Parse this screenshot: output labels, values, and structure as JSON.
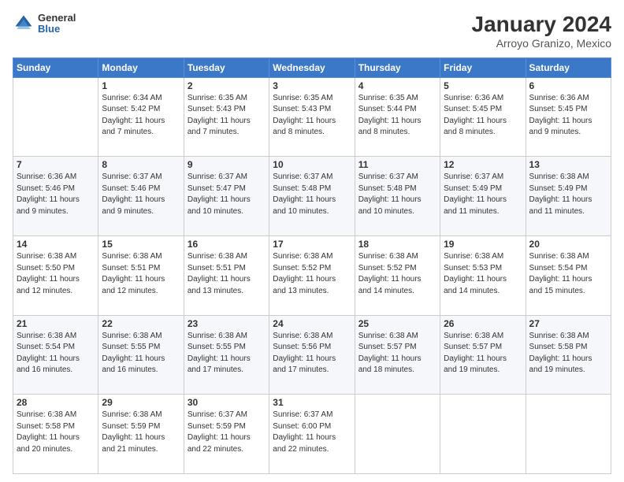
{
  "logo": {
    "general": "General",
    "blue": "Blue"
  },
  "header": {
    "month": "January 2024",
    "location": "Arroyo Granizo, Mexico"
  },
  "weekdays": [
    "Sunday",
    "Monday",
    "Tuesday",
    "Wednesday",
    "Thursday",
    "Friday",
    "Saturday"
  ],
  "weeks": [
    [
      {
        "day": "",
        "info": ""
      },
      {
        "day": "1",
        "info": "Sunrise: 6:34 AM\nSunset: 5:42 PM\nDaylight: 11 hours\nand 7 minutes."
      },
      {
        "day": "2",
        "info": "Sunrise: 6:35 AM\nSunset: 5:43 PM\nDaylight: 11 hours\nand 7 minutes."
      },
      {
        "day": "3",
        "info": "Sunrise: 6:35 AM\nSunset: 5:43 PM\nDaylight: 11 hours\nand 8 minutes."
      },
      {
        "day": "4",
        "info": "Sunrise: 6:35 AM\nSunset: 5:44 PM\nDaylight: 11 hours\nand 8 minutes."
      },
      {
        "day": "5",
        "info": "Sunrise: 6:36 AM\nSunset: 5:45 PM\nDaylight: 11 hours\nand 8 minutes."
      },
      {
        "day": "6",
        "info": "Sunrise: 6:36 AM\nSunset: 5:45 PM\nDaylight: 11 hours\nand 9 minutes."
      }
    ],
    [
      {
        "day": "7",
        "info": "Sunrise: 6:36 AM\nSunset: 5:46 PM\nDaylight: 11 hours\nand 9 minutes."
      },
      {
        "day": "8",
        "info": "Sunrise: 6:37 AM\nSunset: 5:46 PM\nDaylight: 11 hours\nand 9 minutes."
      },
      {
        "day": "9",
        "info": "Sunrise: 6:37 AM\nSunset: 5:47 PM\nDaylight: 11 hours\nand 10 minutes."
      },
      {
        "day": "10",
        "info": "Sunrise: 6:37 AM\nSunset: 5:48 PM\nDaylight: 11 hours\nand 10 minutes."
      },
      {
        "day": "11",
        "info": "Sunrise: 6:37 AM\nSunset: 5:48 PM\nDaylight: 11 hours\nand 10 minutes."
      },
      {
        "day": "12",
        "info": "Sunrise: 6:37 AM\nSunset: 5:49 PM\nDaylight: 11 hours\nand 11 minutes."
      },
      {
        "day": "13",
        "info": "Sunrise: 6:38 AM\nSunset: 5:49 PM\nDaylight: 11 hours\nand 11 minutes."
      }
    ],
    [
      {
        "day": "14",
        "info": "Sunrise: 6:38 AM\nSunset: 5:50 PM\nDaylight: 11 hours\nand 12 minutes."
      },
      {
        "day": "15",
        "info": "Sunrise: 6:38 AM\nSunset: 5:51 PM\nDaylight: 11 hours\nand 12 minutes."
      },
      {
        "day": "16",
        "info": "Sunrise: 6:38 AM\nSunset: 5:51 PM\nDaylight: 11 hours\nand 13 minutes."
      },
      {
        "day": "17",
        "info": "Sunrise: 6:38 AM\nSunset: 5:52 PM\nDaylight: 11 hours\nand 13 minutes."
      },
      {
        "day": "18",
        "info": "Sunrise: 6:38 AM\nSunset: 5:52 PM\nDaylight: 11 hours\nand 14 minutes."
      },
      {
        "day": "19",
        "info": "Sunrise: 6:38 AM\nSunset: 5:53 PM\nDaylight: 11 hours\nand 14 minutes."
      },
      {
        "day": "20",
        "info": "Sunrise: 6:38 AM\nSunset: 5:54 PM\nDaylight: 11 hours\nand 15 minutes."
      }
    ],
    [
      {
        "day": "21",
        "info": "Sunrise: 6:38 AM\nSunset: 5:54 PM\nDaylight: 11 hours\nand 16 minutes."
      },
      {
        "day": "22",
        "info": "Sunrise: 6:38 AM\nSunset: 5:55 PM\nDaylight: 11 hours\nand 16 minutes."
      },
      {
        "day": "23",
        "info": "Sunrise: 6:38 AM\nSunset: 5:55 PM\nDaylight: 11 hours\nand 17 minutes."
      },
      {
        "day": "24",
        "info": "Sunrise: 6:38 AM\nSunset: 5:56 PM\nDaylight: 11 hours\nand 17 minutes."
      },
      {
        "day": "25",
        "info": "Sunrise: 6:38 AM\nSunset: 5:57 PM\nDaylight: 11 hours\nand 18 minutes."
      },
      {
        "day": "26",
        "info": "Sunrise: 6:38 AM\nSunset: 5:57 PM\nDaylight: 11 hours\nand 19 minutes."
      },
      {
        "day": "27",
        "info": "Sunrise: 6:38 AM\nSunset: 5:58 PM\nDaylight: 11 hours\nand 19 minutes."
      }
    ],
    [
      {
        "day": "28",
        "info": "Sunrise: 6:38 AM\nSunset: 5:58 PM\nDaylight: 11 hours\nand 20 minutes."
      },
      {
        "day": "29",
        "info": "Sunrise: 6:38 AM\nSunset: 5:59 PM\nDaylight: 11 hours\nand 21 minutes."
      },
      {
        "day": "30",
        "info": "Sunrise: 6:37 AM\nSunset: 5:59 PM\nDaylight: 11 hours\nand 22 minutes."
      },
      {
        "day": "31",
        "info": "Sunrise: 6:37 AM\nSunset: 6:00 PM\nDaylight: 11 hours\nand 22 minutes."
      },
      {
        "day": "",
        "info": ""
      },
      {
        "day": "",
        "info": ""
      },
      {
        "day": "",
        "info": ""
      }
    ]
  ]
}
